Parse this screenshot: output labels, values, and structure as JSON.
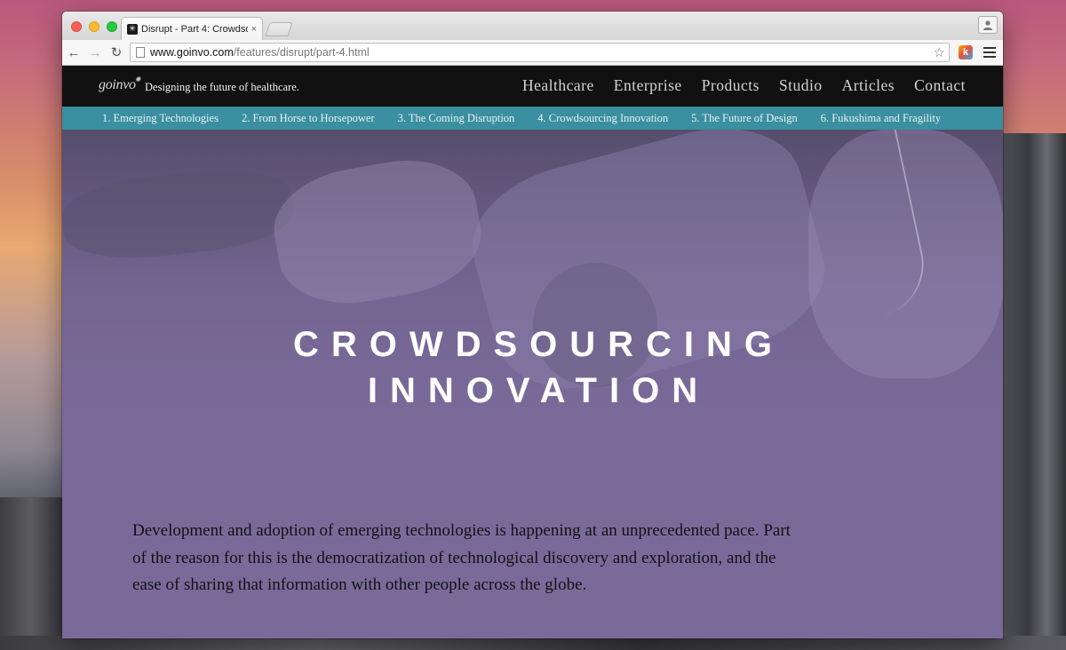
{
  "browser": {
    "tab_title": "Disrupt - Part 4: Crowdsou",
    "tab_close": "×",
    "favicon_glyph": "✳",
    "url_host": "www.goinvo.com",
    "url_path": "/features/disrupt/part-4.html",
    "extension_letter": "k",
    "back_icon": "←",
    "forward_icon": "→",
    "reload_icon": "↻",
    "star_icon": "☆"
  },
  "site": {
    "logo": "goinvo",
    "logo_sun": "✺",
    "tagline": "Designing the future of healthcare.",
    "nav": [
      "Healthcare",
      "Enterprise",
      "Products",
      "Studio",
      "Articles",
      "Contact"
    ],
    "sections": [
      "1. Emerging Technologies",
      "2. From Horse to Horsepower",
      "3. The Coming Disruption",
      "4. Crowdsourcing Innovation",
      "5. The Future of Design",
      "6. Fukushima and Fragility"
    ]
  },
  "hero": {
    "title_line1": "CROWDSOURCING",
    "title_line2": "INNOVATION",
    "intro": "Development and adoption of emerging technologies is happening at an unprecedented pace. Part of the reason for this is the democratization of technological discovery and exploration, and the ease of sharing that information with other people across the globe."
  },
  "colors": {
    "header_bg": "#111111",
    "subnav_bg": "#3a8fa0",
    "hero_bg": "#7a6a9a"
  }
}
